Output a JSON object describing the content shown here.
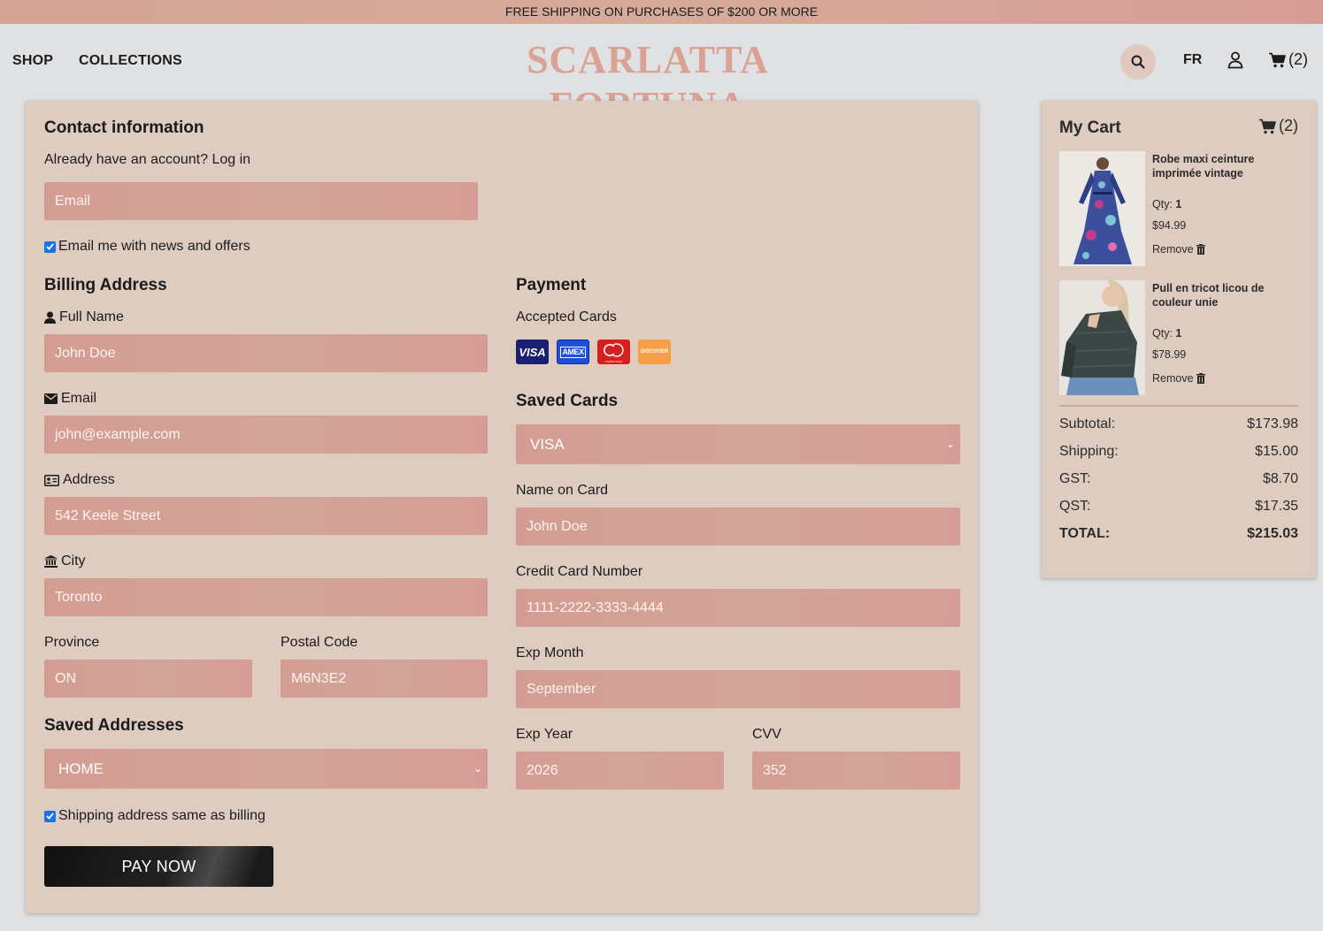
{
  "promo": "FREE SHIPPING ON PURCHASES OF $200 OR MORE",
  "nav": {
    "shop": "SHOP",
    "collections": "COLLECTIONS",
    "brand": "SCARLATTA FORTUNA",
    "lang": "FR",
    "cart_count": "(2)"
  },
  "contact": {
    "title": "Contact information",
    "account_prompt": "Already have an account? Log in",
    "email_placeholder": "Email",
    "news_label": "Email me with news and offers"
  },
  "billing": {
    "title": "Billing Address",
    "full_name_label": "Full Name",
    "full_name": "John Doe",
    "email_label": "Email",
    "email": "john@example.com",
    "address_label": "Address",
    "address": "542 Keele Street",
    "city_label": "City",
    "city": "Toronto",
    "province_label": "Province",
    "province": "ON",
    "postal_label": "Postal Code",
    "postal": "M6N3E2",
    "saved_title": "Saved Addresses",
    "saved_value": "HOME",
    "same_label": "Shipping address same as billing",
    "pay_label": "PAY NOW"
  },
  "payment": {
    "title": "Payment",
    "accepted_label": "Accepted Cards",
    "cards": [
      "VISA",
      "AMEX",
      "mastercard",
      "DISCOVER"
    ],
    "saved_title": "Saved Cards",
    "saved_value": "VISA",
    "name_label": "Name on Card",
    "name": "John Doe",
    "number_label": "Credit Card Number",
    "number": "1111-2222-3333-4444",
    "exp_month_label": "Exp Month",
    "exp_month": "September",
    "exp_year_label": "Exp Year",
    "exp_year": "2026",
    "cvv_label": "CVV",
    "cvv": "352"
  },
  "cart": {
    "title": "My Cart",
    "count": "(2)",
    "items": [
      {
        "name": "Robe maxi ceinture imprimée vintage",
        "qty_label": "Qty:",
        "qty": "1",
        "price": "$94.99",
        "remove": "Remove"
      },
      {
        "name": "Pull en tricot licou de couleur unie",
        "qty_label": "Qty:",
        "qty": "1",
        "price": "$78.99",
        "remove": "Remove"
      }
    ],
    "summary": [
      {
        "label": "Subtotal:",
        "value": "$173.98"
      },
      {
        "label": "Shipping:",
        "value": "$15.00"
      },
      {
        "label": "GST:",
        "value": "$8.70"
      },
      {
        "label": "QST:",
        "value": "$17.35"
      },
      {
        "label": "TOTAL:",
        "value": "$215.03"
      }
    ]
  },
  "colors": {
    "accent": "#d4a096",
    "panel": "#dfccc0",
    "brand": "#dba195",
    "button": "#1b1b1b"
  }
}
